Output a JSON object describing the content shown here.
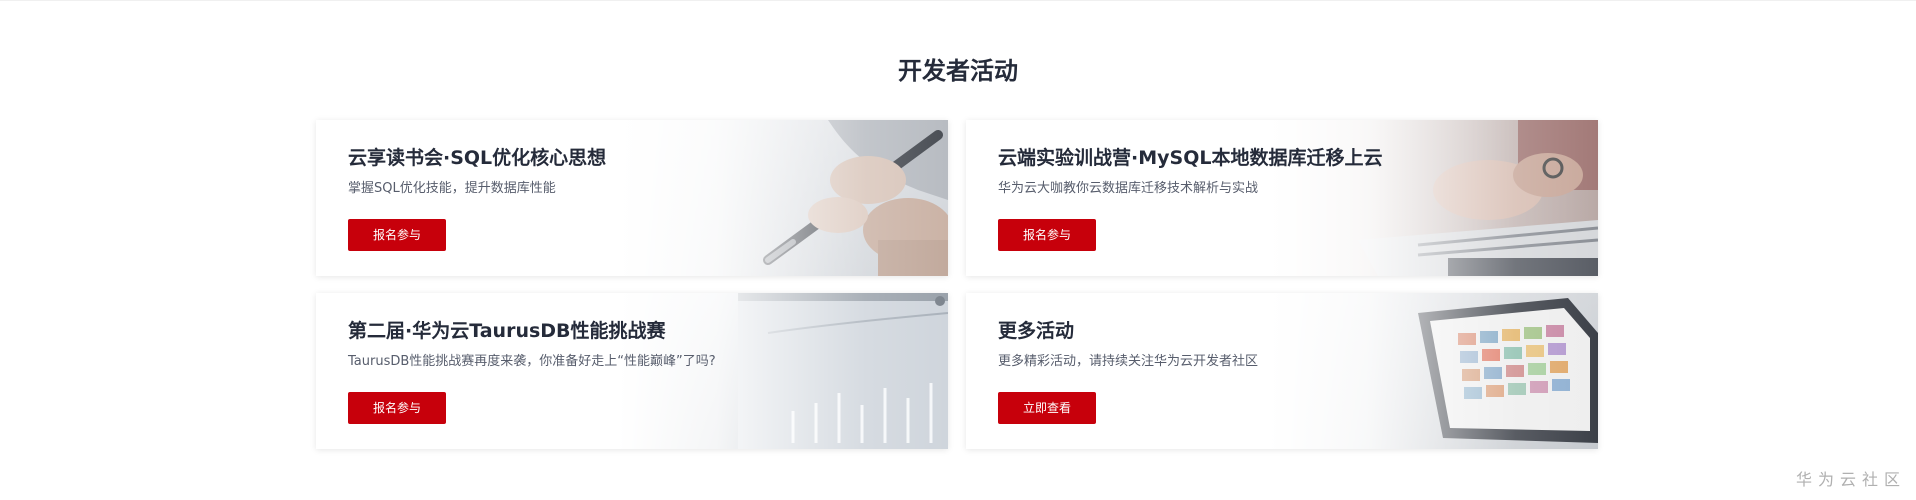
{
  "section": {
    "title": "开发者活动"
  },
  "cards": [
    {
      "title": "云享读书会·SQL优化核心思想",
      "description": "掌握SQL优化技能，提升数据库性能",
      "button_label": "报名参与",
      "illustration": "hand-with-pen"
    },
    {
      "title": "云端实验训战营·MySQL本地数据库迁移上云",
      "description": "华为云大咖教你云数据库迁移技术解析与实战",
      "button_label": "报名参与",
      "illustration": "hands-on-laptop"
    },
    {
      "title": "第二届·华为云TaurusDB性能挑战赛",
      "description": "TaurusDB性能挑战赛再度来袭，你准备好走上“性能巅峰”了吗?",
      "button_label": "报名参与",
      "illustration": "performance-chart-monitor"
    },
    {
      "title": "更多活动",
      "description": "更多精彩活动，请持续关注华为云开发者社区",
      "button_label": "立即查看",
      "illustration": "tablet-with-photos"
    }
  ],
  "watermark": {
    "text": "华为云社区"
  },
  "colors": {
    "accent": "#c7000b",
    "title": "#252b3a",
    "description": "#575d6c",
    "card_background": "#ffffff"
  }
}
